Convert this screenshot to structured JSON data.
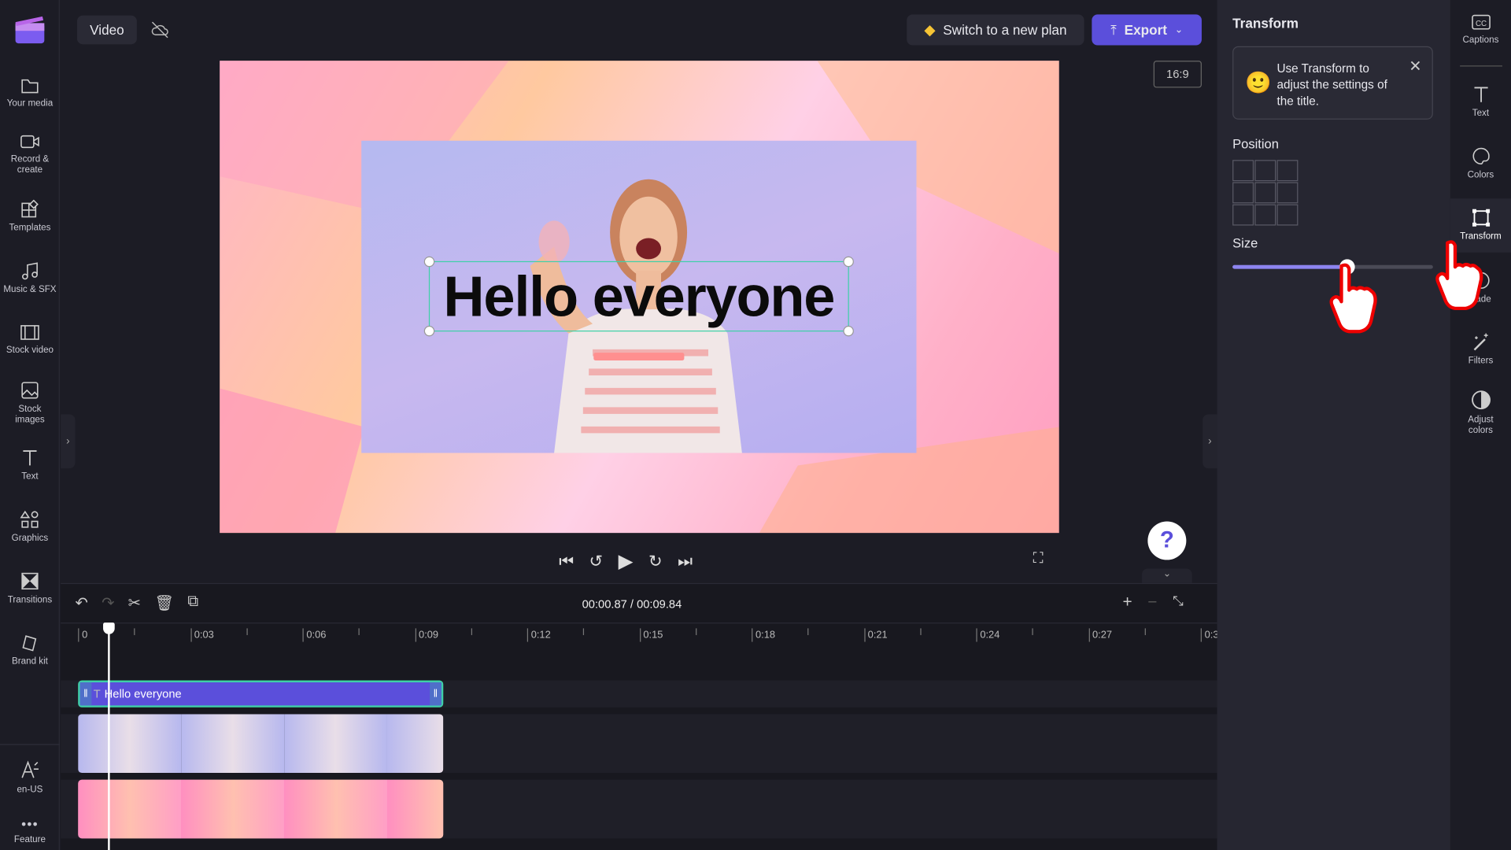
{
  "colors": {
    "accent": "#5b4fdb",
    "selection": "#3fd0a8",
    "bg": "#1c1c25",
    "panel": "#262631"
  },
  "left_sidebar": {
    "items": [
      {
        "label": "Your media",
        "icon": "folder-icon"
      },
      {
        "label": "Record & create",
        "icon": "camera-icon"
      },
      {
        "label": "Templates",
        "icon": "templates-icon"
      },
      {
        "label": "Music & SFX",
        "icon": "music-icon"
      },
      {
        "label": "Stock video",
        "icon": "film-icon"
      },
      {
        "label": "Stock images",
        "icon": "image-icon"
      },
      {
        "label": "Text",
        "icon": "text-icon"
      },
      {
        "label": "Graphics",
        "icon": "shapes-icon"
      },
      {
        "label": "Transitions",
        "icon": "transitions-icon"
      },
      {
        "label": "Brand kit",
        "icon": "brand-kit-icon"
      }
    ],
    "language": "en-US",
    "feature": "Feature"
  },
  "header": {
    "project_name": "Video",
    "upgrade_label": "Switch to a new plan",
    "export_label": "Export",
    "aspect_ratio": "16:9"
  },
  "preview": {
    "title_text": "Hello everyone"
  },
  "playback": {
    "current_time": "00:00.87",
    "total_time": "00:09.84",
    "separator": " / "
  },
  "timeline": {
    "ticks": [
      "0",
      "0:03",
      "0:06",
      "0:09",
      "0:12",
      "0:15",
      "0:18",
      "0:21",
      "0:24",
      "0:27",
      "0:3"
    ],
    "text_clip_label": "Hello everyone"
  },
  "panel": {
    "title": "Transform",
    "tip": "Use Transform to adjust the settings of the title.",
    "position_label": "Position",
    "size_label": "Size",
    "size_value_percent": 57
  },
  "right_sidebar": {
    "items": [
      {
        "label": "Captions",
        "icon": "captions-icon"
      },
      {
        "label": "Text",
        "icon": "text-icon"
      },
      {
        "label": "Colors",
        "icon": "palette-icon"
      },
      {
        "label": "Transform",
        "icon": "transform-icon",
        "active": true
      },
      {
        "label": "Fade",
        "icon": "fade-icon"
      },
      {
        "label": "Filters",
        "icon": "magic-wand-icon"
      },
      {
        "label": "Adjust colors",
        "icon": "contrast-icon"
      }
    ]
  },
  "help": "?"
}
